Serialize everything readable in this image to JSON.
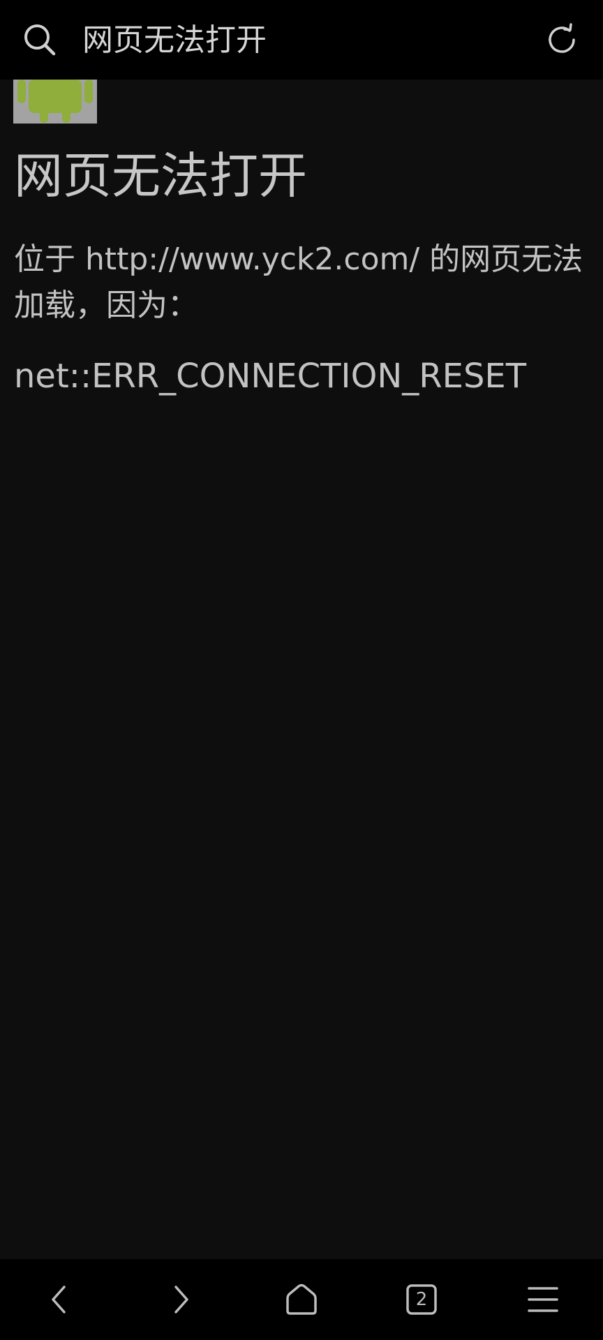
{
  "topbar": {
    "title": "网页无法打开",
    "search_icon": "search-icon",
    "refresh_icon": "refresh-icon"
  },
  "page": {
    "heading": "网页无法打开",
    "message": "位于 http://www.yck2.com/ 的网页无法加载，因为：",
    "error_code": "net::ERR_CONNECTION_RESET",
    "image_icon": "android-robot-image"
  },
  "bottom_nav": {
    "back_icon": "chevron-left-icon",
    "forward_icon": "chevron-right-icon",
    "home_icon": "home-icon",
    "tabs_count": "2",
    "menu_icon": "menu-icon"
  },
  "colors": {
    "background": "#0e0e0e",
    "bar_background": "#000000",
    "text": "#c3c3c3",
    "android_green": "#8fae3b"
  }
}
